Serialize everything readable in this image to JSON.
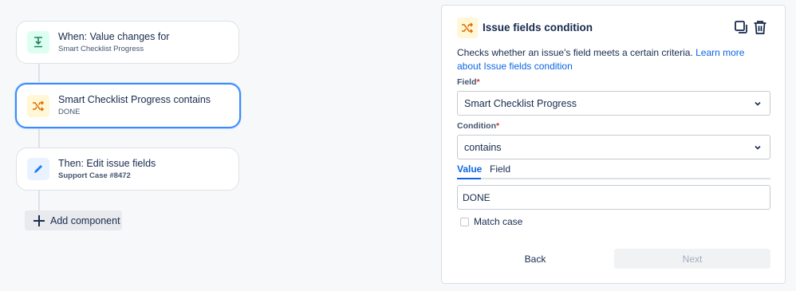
{
  "flow": {
    "trigger": {
      "icon": "download-arrow-icon",
      "title": "When: Value changes for",
      "subtitle": "Smart Checklist Progress"
    },
    "condition": {
      "icon": "shuffle-icon",
      "title": "Smart Checklist Progress contains",
      "subtitle": "DONE"
    },
    "action": {
      "icon": "pencil-icon",
      "title": "Then: Edit issue fields",
      "subtitle": "Support Case #8472"
    },
    "add_component_label": "Add component"
  },
  "panel": {
    "icon": "shuffle-icon",
    "title": "Issue fields condition",
    "tools": [
      "copy-icon",
      "trash-icon"
    ],
    "description": "Checks whether an issue's field meets a certain criteria.",
    "learn_more_link": "Learn more about Issue fields condition",
    "field_label": "Field",
    "field_value": "Smart Checklist Progress",
    "condition_label": "Condition",
    "condition_value": "contains",
    "required_marker": "*",
    "tabs": [
      "Value",
      "Field"
    ],
    "active_tab": "Value",
    "value_input": "DONE",
    "match_case_label": "Match case",
    "match_case_checked": false,
    "back_label": "Back",
    "next_label": "Next"
  },
  "colors": {
    "accent": "#0c66e4",
    "selected_border": "#388bff",
    "trigger_icon": "#1f845a",
    "condition_icon": "#e06c00",
    "action_icon": "#1d7afc"
  }
}
